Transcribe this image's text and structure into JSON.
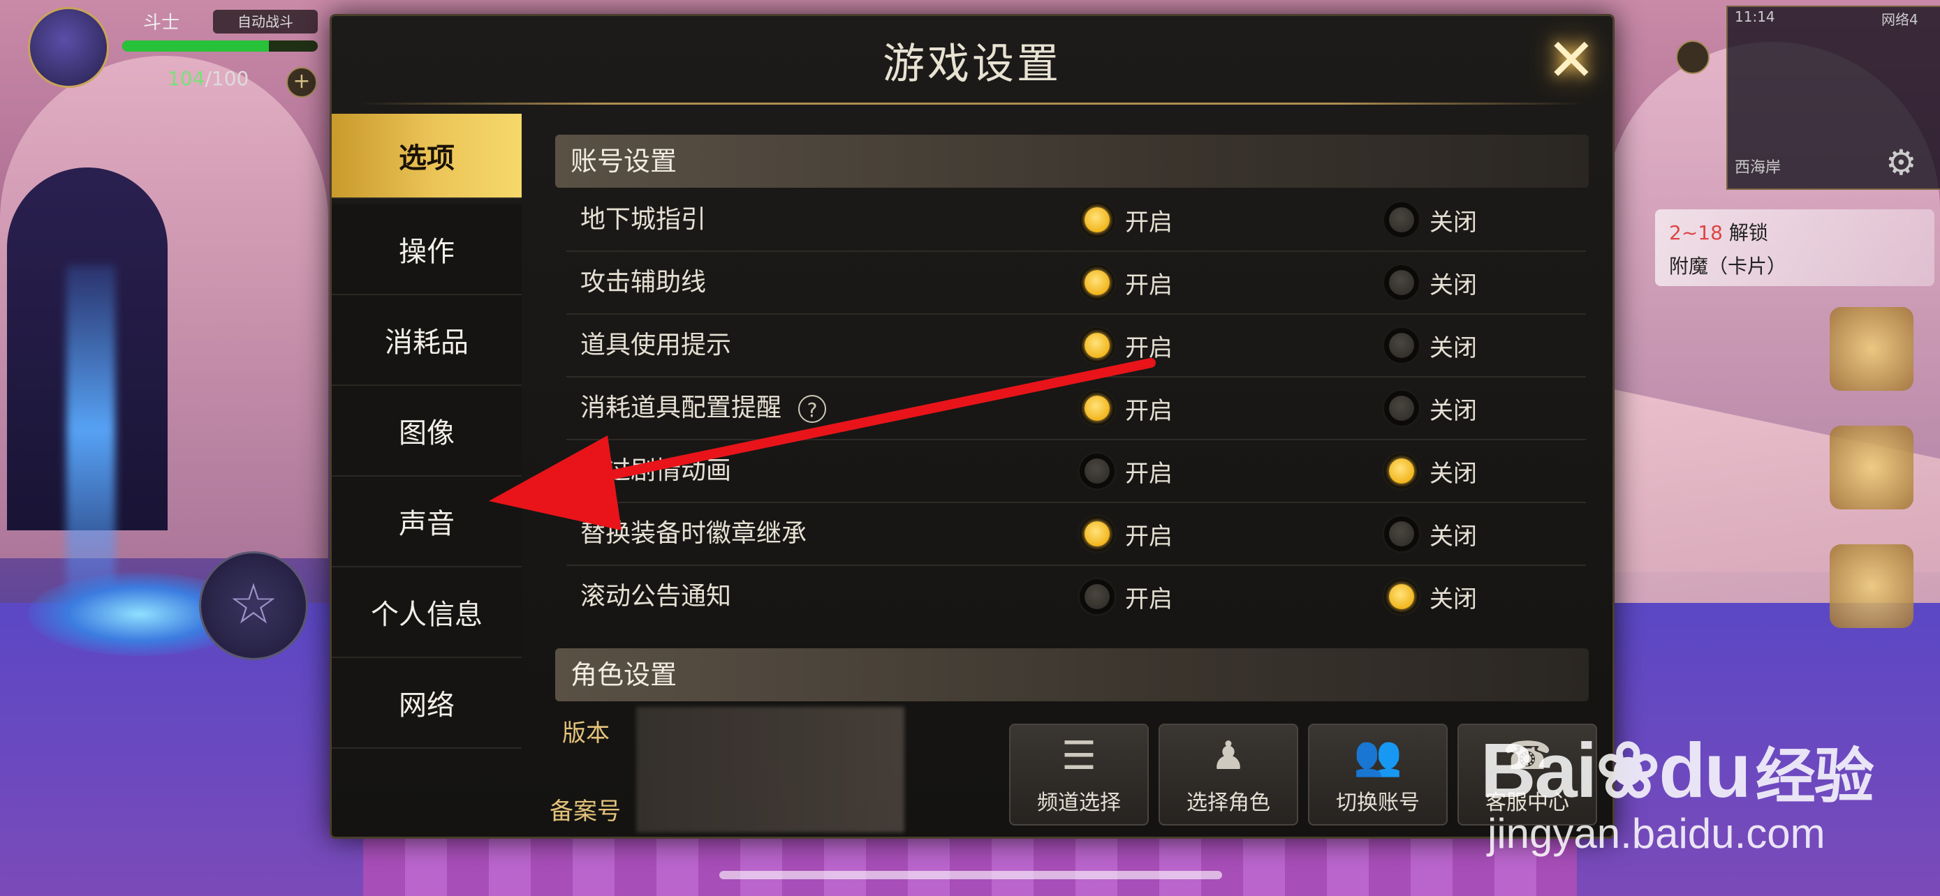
{
  "hud": {
    "player_name": "斗士",
    "auto_button": "自动战斗",
    "hp_fraction": 0.75,
    "fatigue_current": "104",
    "fatigue_max": "/100",
    "plus": "+"
  },
  "minimap": {
    "time": "11:14",
    "right_status": "网络4",
    "location": "西海岸"
  },
  "quest": {
    "level": "2~18",
    "title": "解锁",
    "subtitle": "附魔（卡片）"
  },
  "dialog": {
    "title": "游戏设置",
    "close_glyph": "✕",
    "tabs": [
      {
        "label": "选项",
        "active": true
      },
      {
        "label": "操作",
        "active": false
      },
      {
        "label": "消耗品",
        "active": false
      },
      {
        "label": "图像",
        "active": false
      },
      {
        "label": "声音",
        "active": false
      },
      {
        "label": "个人信息",
        "active": false
      },
      {
        "label": "网络",
        "active": false
      }
    ],
    "account_section": "账号设置",
    "role_section": "角色设置",
    "on_label": "开启",
    "off_label": "关闭",
    "settings": [
      {
        "label": "地下城指引",
        "value": "on"
      },
      {
        "label": "攻击辅助线",
        "value": "on"
      },
      {
        "label": "道具使用提示",
        "value": "on"
      },
      {
        "label": "消耗道具配置提醒",
        "value": "on",
        "help": "?"
      },
      {
        "label": "跳过剧情动画",
        "value": "off"
      },
      {
        "label": "替换装备时徽章继承",
        "value": "on"
      },
      {
        "label": "滚动公告通知",
        "value": "off"
      }
    ],
    "version_label": "版本",
    "record_label": "备案号",
    "footer_buttons": [
      {
        "label": "频道选择",
        "icon": "list-icon"
      },
      {
        "label": "选择角色",
        "icon": "character-icon"
      },
      {
        "label": "切换账号",
        "icon": "users-icon"
      },
      {
        "label": "客服中心",
        "icon": "support-icon"
      }
    ]
  },
  "watermark": {
    "logo": "Bai",
    "logo_tail": "du",
    "logo_cn": "经验",
    "url": "jingyan.baidu.com"
  },
  "colors": {
    "accent_gold": "#f2b61e",
    "arrow_red": "#e8141a",
    "active_tab": "#ecc558"
  }
}
